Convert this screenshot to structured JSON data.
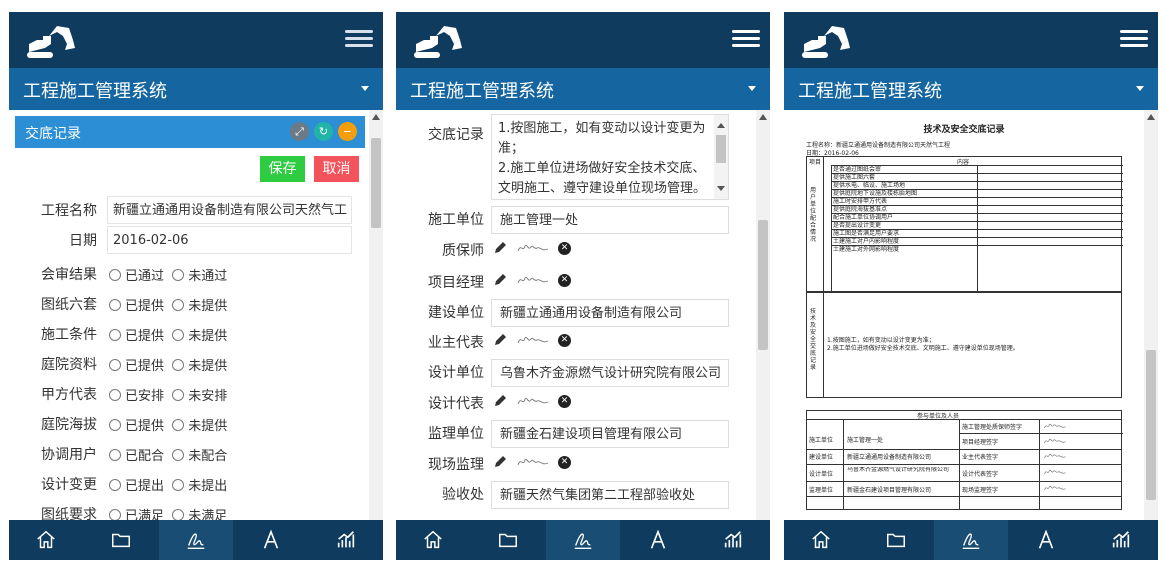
{
  "app": {
    "title": "工程施工管理系统",
    "colors": {
      "topbar": "#0e3b5e",
      "titlebar": "#1565a0",
      "panel_header": "#2c8fd6",
      "save": "#2ecc40",
      "cancel": "#f3545b"
    },
    "bottom_nav": [
      "home-icon",
      "folder-icon",
      "signature-icon",
      "font-icon",
      "chart-icon"
    ]
  },
  "panel1": {
    "header": "交底记录",
    "header_icons": [
      "expand-icon",
      "refresh-icon",
      "minus-icon"
    ],
    "save_label": "保存",
    "cancel_label": "取消",
    "project_label": "工程名称",
    "project_value": "新疆立通通用设备制造有限公司天然气工",
    "date_label": "日期",
    "date_value": "2016-02-06",
    "rows": [
      {
        "label": "会审结果",
        "opt1": "已通过",
        "opt2": "未通过"
      },
      {
        "label": "图纸六套",
        "opt1": "已提供",
        "opt2": "未提供"
      },
      {
        "label": "施工条件",
        "opt1": "已提供",
        "opt2": "未提供"
      },
      {
        "label": "庭院资料",
        "opt1": "已提供",
        "opt2": "未提供"
      },
      {
        "label": "甲方代表",
        "opt1": "已安排",
        "opt2": "未安排"
      },
      {
        "label": "庭院海拔",
        "opt1": "已提供",
        "opt2": "未提供"
      },
      {
        "label": "协调用户",
        "opt1": "已配合",
        "opt2": "未配合"
      },
      {
        "label": "设计变更",
        "opt1": "已提出",
        "opt2": "未提出"
      },
      {
        "label": "图纸要求",
        "opt1": "已满足",
        "opt2": "未满足"
      }
    ]
  },
  "panel2": {
    "record_label": "交底记录",
    "record_text": "1.按图施工，如有变动以设计变更为准；\n2.施工单位进场做好安全技术交底、文明施工、遵守建设单位现场管理。",
    "construction_unit_label": "施工单位",
    "construction_unit_value": "施工管理一处",
    "warranty_label": "质保师",
    "pm_label": "项目经理",
    "build_unit_label": "建设单位",
    "build_unit_value": "新疆立通通用设备制造有限公司",
    "owner_rep_label": "业主代表",
    "design_unit_label": "设计单位",
    "design_unit_value": "乌鲁木齐金源燃气设计研究院有限公司",
    "design_rep_label": "设计代表",
    "supervision_unit_label": "监理单位",
    "supervision_unit_value": "新疆金石建设项目管理有限公司",
    "site_supervisor_label": "现场监理",
    "acceptance_label": "验收处",
    "acceptance_value": "新疆天然气集团第二工程部验收处"
  },
  "panel3": {
    "doc_title": "技术及安全交底记录",
    "project_line": "工程名称：新疆立通通用设备制造有限公司天然气工程",
    "date_line": "日期：2016-02-06",
    "col_item": "项目",
    "col_content": "内容",
    "side_label_1": "用户单位配合情况",
    "items": [
      "是否通过图纸会审",
      "提供施工图六套",
      "提供水电、临设、施工场地",
      "提供庭院地下设施及楼栋胎地图",
      "施工时安排甲方代表",
      "提供庭院海拔基准点",
      "配合施工单位协调用户",
      "是否提出设计变更",
      "施工图是否满足用户要求",
      "土建施工对户内影响程度",
      "土建施工对外网影响程度"
    ],
    "side_label_2": "技术及安全交底记录",
    "record_lines": [
      "1.按图施工，如有变动以设计变更为准；",
      "2.施工单位进场做好安全技术交底、文明施工、遵守建设单位现场管理。"
    ],
    "participants_header": "参与单位及人员",
    "participants": [
      {
        "unit_label": "施工单位",
        "unit": "施工管理一处",
        "role1": "施工管理处质保师签字",
        "role2": "项目经理签字"
      },
      {
        "unit_label": "建设单位",
        "unit": "新疆立通通用设备制造有限公司",
        "role1": "业主代表签字"
      },
      {
        "unit_label": "设计单位",
        "unit": "乌鲁木齐金源燃气设计研究院有限公司",
        "role1": "设计代表签字"
      },
      {
        "unit_label": "监理单位",
        "unit": "新疆金石建设项目管理有限公司",
        "role1": "现场监理签字"
      }
    ]
  }
}
